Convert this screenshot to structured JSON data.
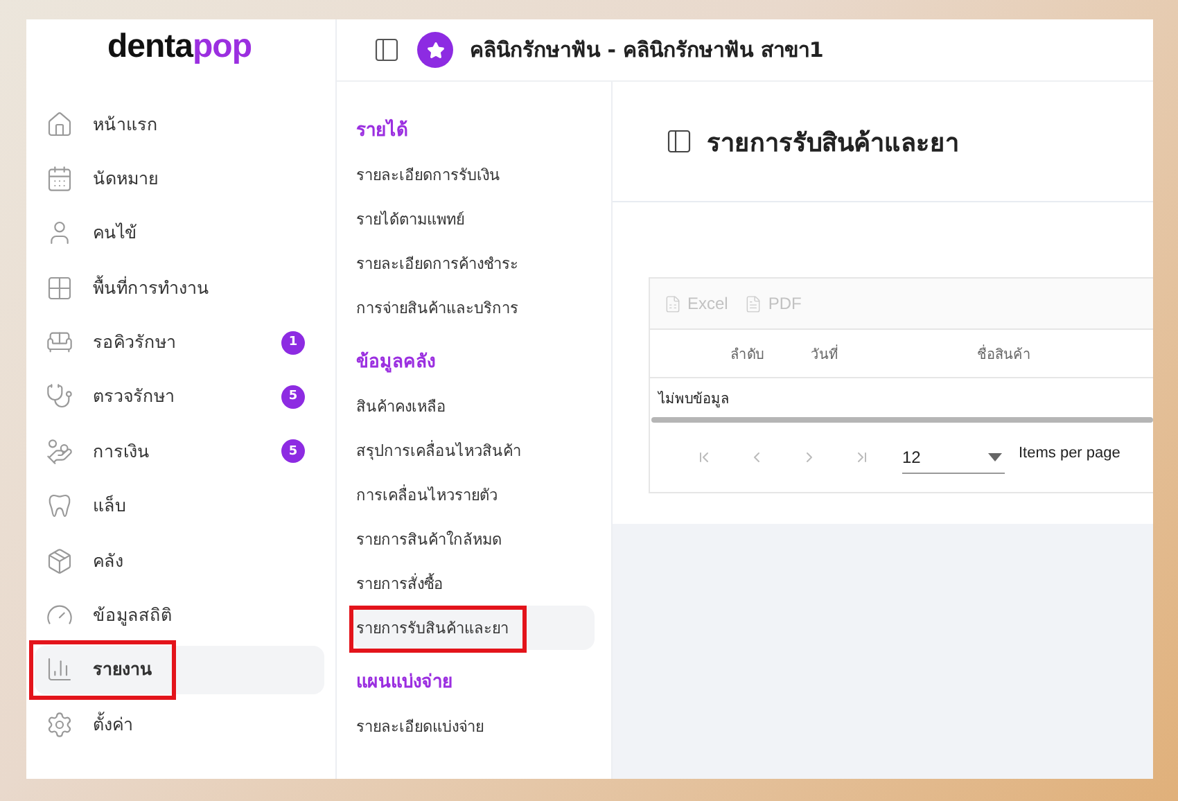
{
  "logo": {
    "text": "denta",
    "accent": "pop"
  },
  "nav": [
    {
      "kind": "home",
      "label": "หน้าแรก",
      "selected": false,
      "highlighted": false
    },
    {
      "kind": "calendar",
      "label": "นัดหมาย",
      "selected": false,
      "highlighted": false
    },
    {
      "kind": "user",
      "label": "คนไข้",
      "selected": false,
      "highlighted": false
    },
    {
      "kind": "workspace",
      "label": "พื้นที่การทำงาน",
      "selected": false,
      "highlighted": false
    },
    {
      "kind": "chair",
      "label": "รอคิวรักษา",
      "badge": "1",
      "selected": false,
      "highlighted": false
    },
    {
      "kind": "tools",
      "label": "ตรวจรักษา",
      "badge": "5",
      "selected": false,
      "highlighted": false
    },
    {
      "kind": "money",
      "label": "การเงิน",
      "badge": "5",
      "selected": false,
      "highlighted": false
    },
    {
      "kind": "tooth",
      "label": "แล็บ",
      "selected": false,
      "highlighted": false
    },
    {
      "kind": "box",
      "label": "คลัง",
      "selected": false,
      "highlighted": false
    },
    {
      "kind": "gauge",
      "label": "ข้อมูลสถิติ",
      "selected": false,
      "highlighted": false
    },
    {
      "kind": "chart",
      "label": "รายงาน",
      "selected": true,
      "highlighted": true
    },
    {
      "kind": "settings",
      "label": "ตั้งค่า",
      "selected": false,
      "highlighted": false
    }
  ],
  "header": {
    "clinic": "คลินิกรักษาฟัน - คลินิกรักษาฟัน สาขา1"
  },
  "submenu": [
    {
      "title": "รายได้",
      "items": [
        {
          "label": "รายละเอียดการรับเงิน",
          "selected": false,
          "highlighted": false
        },
        {
          "label": "รายได้ตามแพทย์",
          "selected": false,
          "highlighted": false
        },
        {
          "label": "รายละเอียดการค้างชำระ",
          "selected": false,
          "highlighted": false
        },
        {
          "label": "การจ่ายสินค้าและบริการ",
          "selected": false,
          "highlighted": false
        }
      ]
    },
    {
      "title": "ข้อมูลคลัง",
      "items": [
        {
          "label": "สินค้าคงเหลือ",
          "selected": false,
          "highlighted": false
        },
        {
          "label": "สรุปการเคลื่อนไหวสินค้า",
          "selected": false,
          "highlighted": false
        },
        {
          "label": "การเคลื่อนไหวรายตัว",
          "selected": false,
          "highlighted": false
        },
        {
          "label": "รายการสินค้าใกล้หมด",
          "selected": false,
          "highlighted": false
        },
        {
          "label": "รายการสั่งซื้อ",
          "selected": false,
          "highlighted": false
        },
        {
          "label": "รายการรับสินค้าและยา",
          "selected": true,
          "highlighted": true
        }
      ]
    },
    {
      "title": "แผนแบ่งจ่าย",
      "items": [
        {
          "label": "รายละเอียดแบ่งจ่าย",
          "selected": false,
          "highlighted": false
        }
      ]
    }
  ],
  "page": {
    "title": "รายการรับสินค้าและยา"
  },
  "table": {
    "exports": [
      {
        "kind": "excel",
        "label": "Excel",
        "disabled": true
      },
      {
        "kind": "pdf",
        "label": "PDF",
        "disabled": true
      }
    ],
    "columns": [
      "ลำดับ",
      "วันที่",
      "ชื่อสินค้า"
    ],
    "empty": "ไม่พบข้อมูล",
    "pager": {
      "page_size": "12",
      "size_label": "Items per page"
    }
  }
}
